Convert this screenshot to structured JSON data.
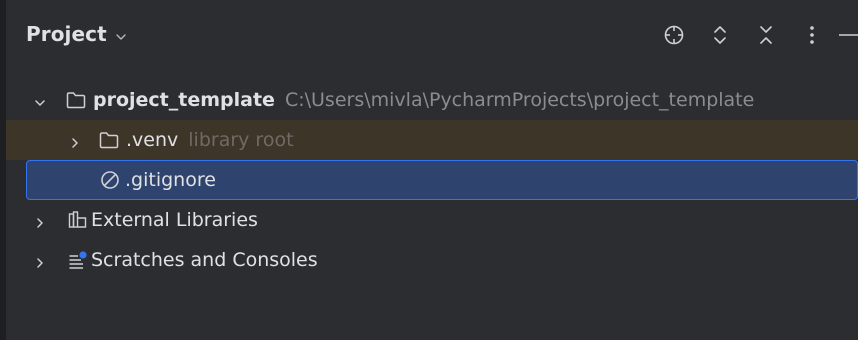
{
  "header": {
    "title": "Project",
    "title_dropdown_icon": "chevron-down-icon",
    "actions": [
      {
        "name": "locate-icon",
        "label": "Select Opened File"
      },
      {
        "name": "expand-all-icon",
        "label": "Expand All"
      },
      {
        "name": "collapse-all-icon",
        "label": "Collapse All"
      },
      {
        "name": "more-options-icon",
        "label": "Options"
      },
      {
        "name": "hide-panel-icon",
        "label": "Hide"
      }
    ]
  },
  "tree": {
    "root": {
      "name": "project_template",
      "path": "C:\\Users\\mivla\\PycharmProjects\\project_template",
      "expanded": true,
      "icon": "folder-icon"
    },
    "venv": {
      "name": ".venv",
      "hint": "library root",
      "expanded": false,
      "icon": "folder-icon"
    },
    "gitignore": {
      "name": ".gitignore",
      "icon": "ignored-file-icon",
      "selected": true
    },
    "external": {
      "name": "External Libraries",
      "icon": "library-icon",
      "expanded": false
    },
    "scratches": {
      "name": "Scratches and Consoles",
      "icon": "scratches-icon",
      "expanded": false
    }
  },
  "colors": {
    "background": "#2b2d30",
    "selection": "#2e436e",
    "selection_border": "#3574f0",
    "excluded_row": "#3e3529",
    "text": "#dfe1e5",
    "hint": "#8a8c91",
    "badge": "#3574f0"
  }
}
